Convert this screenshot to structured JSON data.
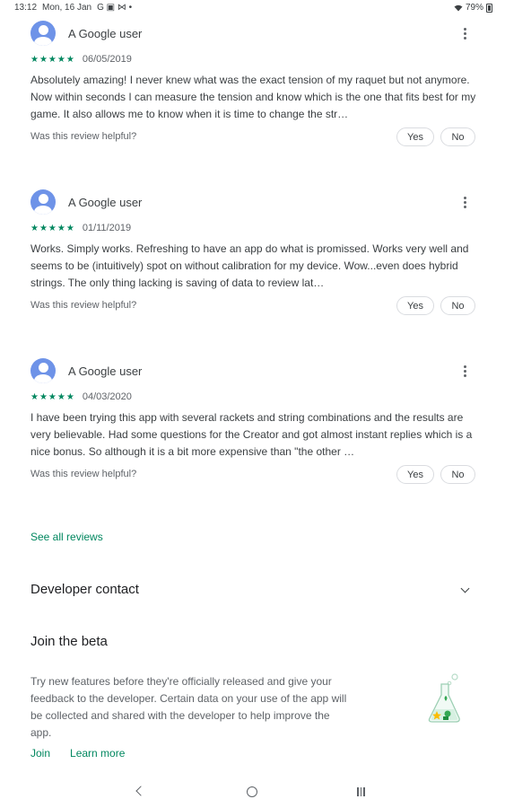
{
  "status_bar": {
    "time": "13:12",
    "date": "Mon, 16 Jan",
    "notification_icons": "G ▣ ⋈ •",
    "battery": "79%"
  },
  "reviews": [
    {
      "reviewer": "A Google user",
      "stars": "★★★★★",
      "rating": 5,
      "date": "06/05/2019",
      "text": "Absolutely amazing! I never knew what was the exact tension of my raquet but not anymore. Now within seconds I can measure the tension and know which is the one that fits best for my game. It also allows me to know when it is time to change the str…",
      "helpful_label": "Was this review helpful?",
      "yes_label": "Yes",
      "no_label": "No"
    },
    {
      "reviewer": "A Google user",
      "stars": "★★★★★",
      "rating": 5,
      "date": "01/11/2019",
      "text": "Works. Simply works. Refreshing to have an app do what is promissed. Works very well and seems to be (intuitively) spot on without calibration for my device. Wow...even does hybrid strings. The only thing lacking is saving of data to review lat…",
      "helpful_label": "Was this review helpful?",
      "yes_label": "Yes",
      "no_label": "No"
    },
    {
      "reviewer": "A Google user",
      "stars": "★★★★★",
      "rating": 5,
      "date": "04/03/2020",
      "text": "I have been trying this app with several rackets and string combinations and the results are very believable. Had some questions for the Creator and got almost instant replies which is a nice bonus. So although it is a bit more expensive than \"the other …",
      "helpful_label": "Was this review helpful?",
      "yes_label": "Yes",
      "no_label": "No"
    }
  ],
  "see_all_reviews": "See all reviews",
  "developer_contact": {
    "title": "Developer contact"
  },
  "beta": {
    "title": "Join the beta",
    "description": "Try new features before they're officially released and give your feedback to the developer. Certain data on your use of the app will be collected and shared with the developer to help improve the app.",
    "join_label": "Join",
    "learn_more_label": "Learn more"
  },
  "colors": {
    "accent": "#01875f",
    "avatar": "#6e93e8",
    "text_primary": "#202124",
    "text_secondary": "#5f6368"
  },
  "icons": {
    "more": "more-vert-icon",
    "avatar": "person-avatar-icon",
    "chevron": "chevron-down-icon",
    "beta": "flask-beta-icon",
    "nav_back": "back-icon",
    "nav_home": "home-icon",
    "nav_recents": "recents-icon"
  }
}
